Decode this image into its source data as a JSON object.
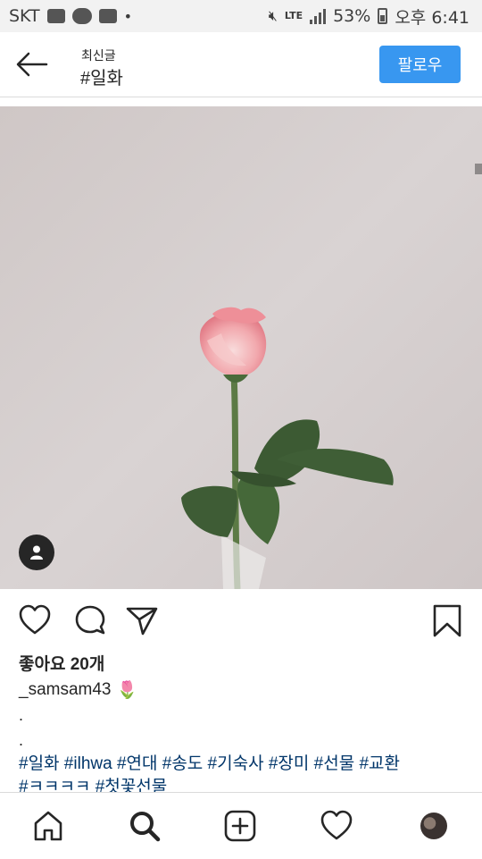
{
  "status_bar": {
    "carrier": "SKT",
    "dot": "•",
    "battery": "53%",
    "time": "오후 6:41",
    "network": "LTE"
  },
  "header": {
    "subtitle": "최신글",
    "title": "#일화",
    "follow_label": "팔로우"
  },
  "post": {
    "likes": "좋아요 20개",
    "username": "_samsam43",
    "caption_emoji": "🌷",
    "dots": [
      ".",
      "."
    ],
    "hashtags_line1": "#일화 #ilhwa #연대 #송도 #기숙사 #장미 #선물 #교환",
    "hashtags_line2": "#ㅋㅋㅋㅋ #첫꽃선물"
  },
  "colors": {
    "accent": "#3897f0",
    "hashtag": "#003569",
    "text": "#262626"
  },
  "icons": [
    "back-arrow-icon",
    "heart-icon",
    "comment-icon",
    "share-icon",
    "bookmark-icon",
    "home-icon",
    "search-icon",
    "add-post-icon",
    "activity-heart-icon",
    "profile-avatar",
    "user-tag-icon"
  ]
}
